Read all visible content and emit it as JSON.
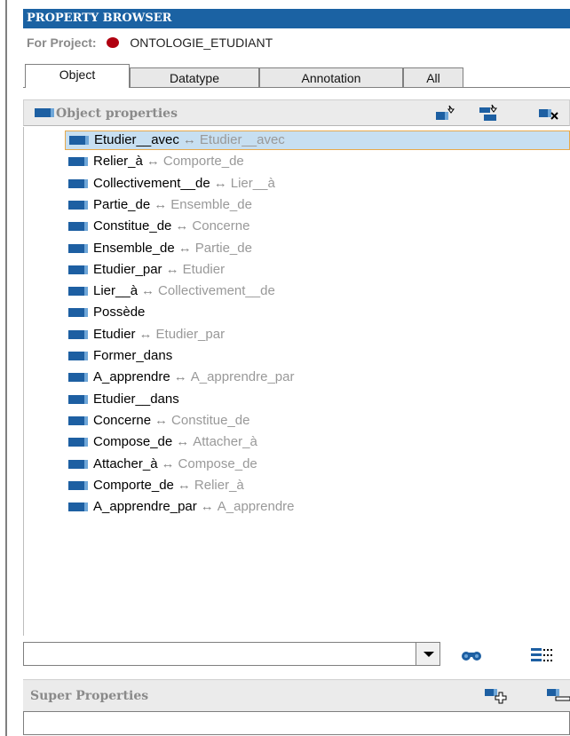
{
  "header": {
    "title": "PROPERTY BROWSER"
  },
  "project": {
    "label": "For Project:",
    "name": "ONTOLOGIE_ETUDIANT"
  },
  "tabs": [
    {
      "label": "Object"
    },
    {
      "label": "Datatype"
    },
    {
      "label": "Annotation"
    },
    {
      "label": "All"
    }
  ],
  "object_panel": {
    "title": "Object properties"
  },
  "properties": [
    {
      "name": "Etudier__avec",
      "inverse": "Etudier__avec"
    },
    {
      "name": "Relier_à",
      "inverse": "Comporte_de"
    },
    {
      "name": "Collectivement__de",
      "inverse": "Lier__à"
    },
    {
      "name": "Partie_de",
      "inverse": "Ensemble_de"
    },
    {
      "name": "Constitue_de",
      "inverse": "Concerne"
    },
    {
      "name": "Ensemble_de",
      "inverse": "Partie_de"
    },
    {
      "name": "Etudier_par",
      "inverse": "Etudier"
    },
    {
      "name": "Lier__à",
      "inverse": "Collectivement__de"
    },
    {
      "name": "Possède",
      "inverse": ""
    },
    {
      "name": "Etudier",
      "inverse": "Etudier_par"
    },
    {
      "name": "Former_dans",
      "inverse": ""
    },
    {
      "name": "A_apprendre",
      "inverse": "A_apprendre_par"
    },
    {
      "name": "Etudier__dans",
      "inverse": ""
    },
    {
      "name": "Concerne",
      "inverse": "Constitue_de"
    },
    {
      "name": "Compose_de",
      "inverse": "Attacher_à"
    },
    {
      "name": "Attacher_à",
      "inverse": "Compose_de"
    },
    {
      "name": "Comporte_de",
      "inverse": "Relier_à"
    },
    {
      "name": "A_apprendre_par",
      "inverse": "A_apprendre"
    }
  ],
  "arrow_symbol": "↔",
  "search": {
    "value": ""
  },
  "super_panel": {
    "title": "Super Properties"
  },
  "colors": {
    "title_bar": "#1b62a3",
    "selection": "#c7dff1",
    "selection_border": "#e7a94b",
    "property_icon": "#1d5fa2",
    "project_dot": "#b00010"
  }
}
